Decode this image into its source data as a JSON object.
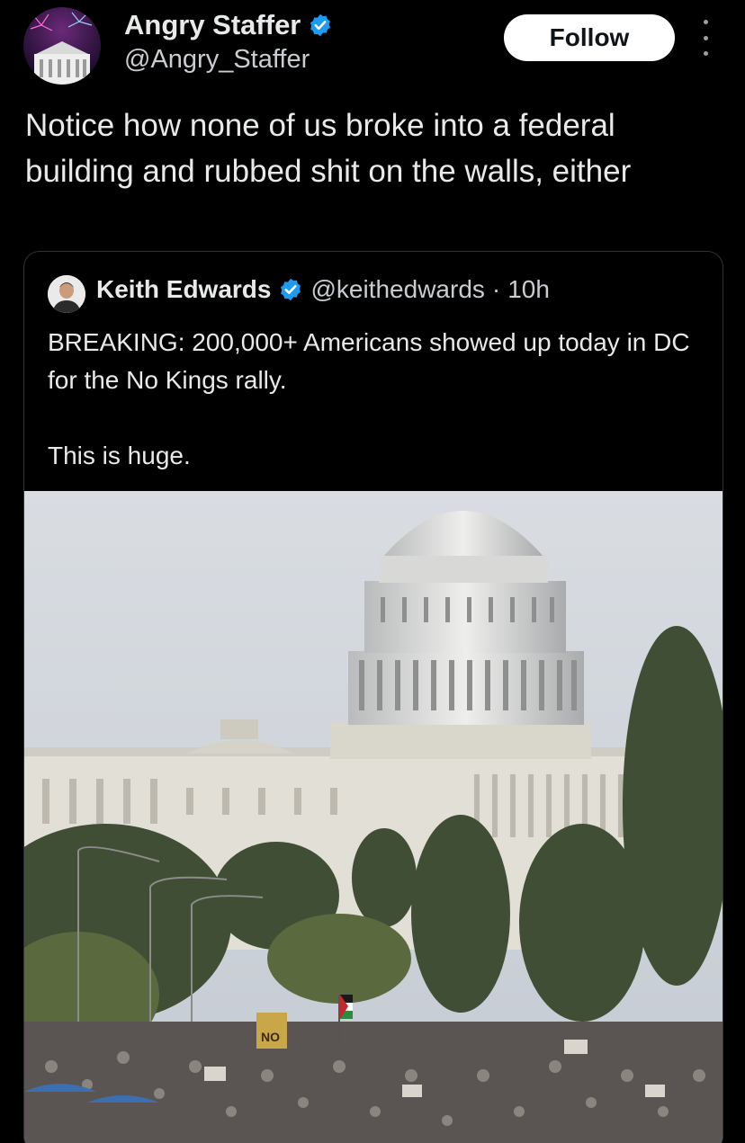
{
  "post": {
    "author_name": "Angry Staffer",
    "author_handle": "@Angry_Staffer",
    "follow_label": "Follow",
    "text": "Notice how none of us broke into a federal building and rubbed shit on the walls, either"
  },
  "quote": {
    "author_name": "Keith Edwards",
    "author_handle": "@keithedwards",
    "separator": "·",
    "time": "10h",
    "line1": "BREAKING: 200,000+ Americans showed up today in DC for the No Kings rally.",
    "line2": "This is huge.",
    "sign_text": "NO"
  },
  "colors": {
    "background": "#000000",
    "text": "#e7e9ea",
    "secondary_text": "#c9ccd0",
    "verified": "#1d9bf0",
    "follow_bg": "#ffffff"
  },
  "icons": {
    "verified": "verified-badge-icon",
    "more": "more-options-icon"
  }
}
